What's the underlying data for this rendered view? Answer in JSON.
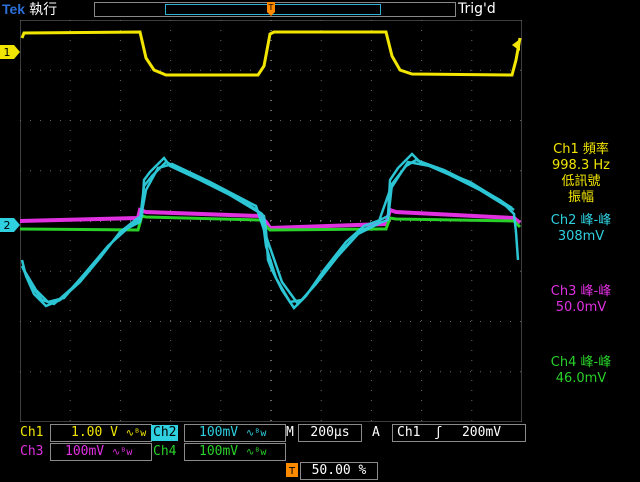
{
  "brand": {
    "logo": "Tek",
    "status": "執行"
  },
  "trigger_status": "Trig'd",
  "trigger_marker": "T",
  "channel_markers": {
    "ch1": "1",
    "ch2": "2"
  },
  "measurements": [
    {
      "title": "Ch1 頻率",
      "value": "998.3 Hz",
      "note1": "低訊號",
      "note2": "振幅",
      "color": "#f2e600"
    },
    {
      "title": "Ch2 峰-峰",
      "value": "308mV",
      "color": "#2fd0e0"
    },
    {
      "title": "Ch3 峰-峰",
      "value": "50.0mV",
      "color": "#e030e0"
    },
    {
      "title": "Ch4 峰-峰",
      "value": "46.0mV",
      "color": "#28d028"
    }
  ],
  "bottom": {
    "ch1": {
      "label": "Ch1",
      "scale": "1.00 V",
      "coupling": "∿ᴮw"
    },
    "ch2": {
      "label": "Ch2",
      "scale": "100mV",
      "coupling": "∿ᴮw"
    },
    "ch3": {
      "label": "Ch3",
      "scale": "100mV",
      "coupling": "∿ᴮw"
    },
    "ch4": {
      "label": "Ch4",
      "scale": "100mV",
      "coupling": "∿ᴮw"
    },
    "timebase_label": "M",
    "timebase": "200µs",
    "trigger_mode": "A",
    "trigger_source": "Ch1",
    "trigger_slope": "ʃ",
    "trigger_level": "200mV",
    "trigger_position_icon": "T",
    "trigger_position": "50.00 %"
  },
  "colors": {
    "ch1": "#f2e600",
    "ch2": "#2fd0e0",
    "ch3": "#e030e0",
    "ch4": "#28d028",
    "grid": "#666666"
  }
}
